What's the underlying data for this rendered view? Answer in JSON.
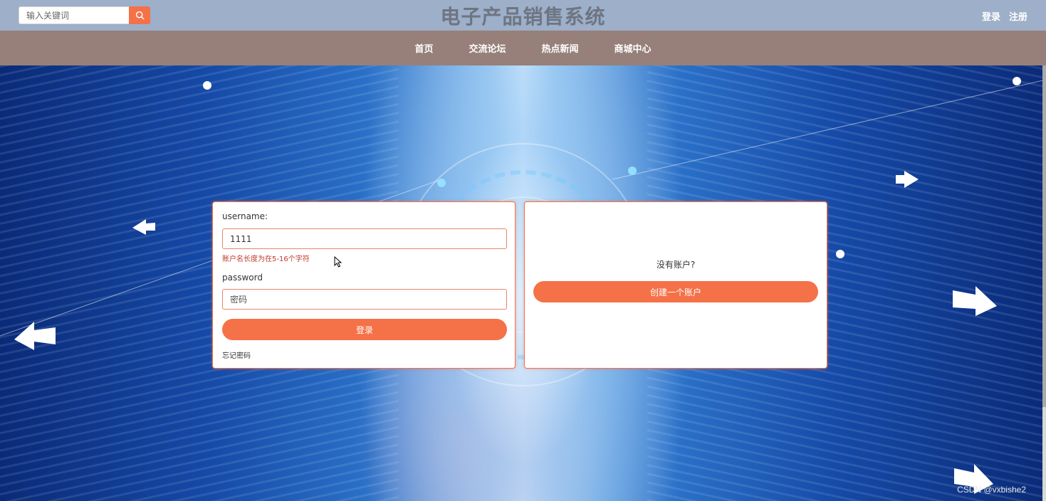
{
  "header": {
    "search_placeholder": "输入关键词",
    "search_icon": "search-icon",
    "site_title": "电子产品销售系统",
    "login_link": "登录",
    "register_link": "注册"
  },
  "nav": {
    "items": [
      {
        "label": "首页"
      },
      {
        "label": "交流论坛"
      },
      {
        "label": "热点新闻"
      },
      {
        "label": "商城中心"
      }
    ]
  },
  "login_form": {
    "username_label": "username:",
    "username_value": "1111",
    "username_error": "账户名长度为在5-16个字符",
    "password_label": "password",
    "password_placeholder": "密码",
    "submit_label": "登录",
    "forgot_label": "忘记密码"
  },
  "signup_panel": {
    "prompt": "没有账户?",
    "create_label": "创建一个账户"
  },
  "watermark": "CSDN @vxbishe2",
  "colors": {
    "accent": "#f57147",
    "topbar": "#9dafc9",
    "navbar": "#968079",
    "error": "#c0392b"
  }
}
